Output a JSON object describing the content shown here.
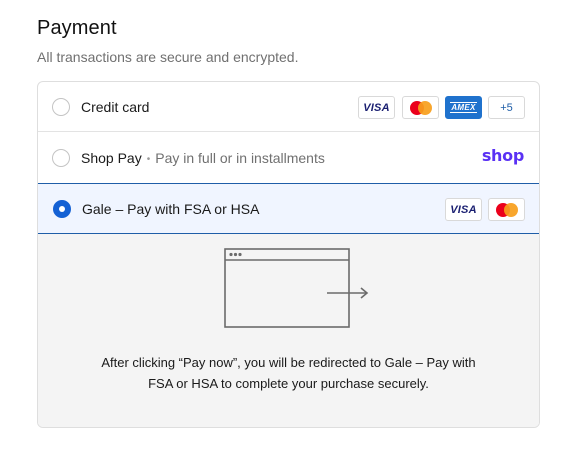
{
  "header": {
    "title": "Payment",
    "subtitle": "All transactions are secure and encrypted."
  },
  "methods": {
    "credit_card": {
      "label": "Credit card",
      "selected": false,
      "cards": [
        "VISA",
        "mastercard",
        "AMEX",
        "+5"
      ]
    },
    "shop_pay": {
      "label": "Shop Pay",
      "separator": "•",
      "hint": "Pay in full or in installments",
      "logo": "shop",
      "logo_color": "#5a31f4",
      "selected": false
    },
    "gale": {
      "label": "Gale – Pay with FSA or HSA",
      "selected": true,
      "cards": [
        "VISA",
        "mastercard"
      ]
    }
  },
  "detail": {
    "illustration": "browser-window-redirect-icon",
    "message": "After clicking “Pay now”, you will be redirected to Gale – Pay with FSA or HSA to complete your purchase securely."
  },
  "colors": {
    "accent": "#1461d4",
    "selected_bg": "#f0f5ff",
    "visa": "#1a1f71",
    "amex": "#1f72cd"
  }
}
